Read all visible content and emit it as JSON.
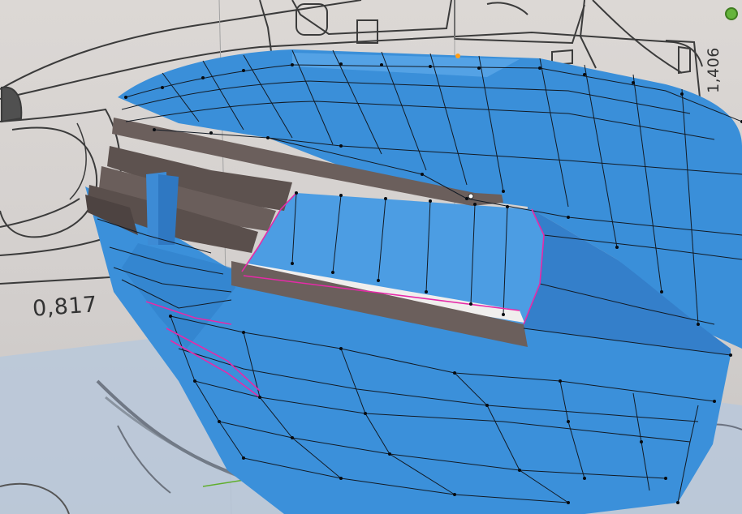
{
  "viewport": {
    "dimension_width": "0,817",
    "dimension_height": "1,406"
  },
  "colors": {
    "mesh_face": "#3a8fd9",
    "mesh_shadow": "#2c6fb6",
    "mesh_highlight": "#6ab2ee",
    "wire": "#121a24",
    "vertex": "#070b10",
    "seam": "#e62aa8",
    "grille": "#6b5f5c",
    "grille_dark": "#4d4341",
    "blueprint_bg": "#d9d6d3",
    "blueprint_line": "#3b3b3b",
    "floor": "#b8c7d8",
    "axis_green": "#5fae2b",
    "active_vertex": "#ff9f1a"
  },
  "icons": {
    "gizmo": "green-axis-gizmo-icon"
  }
}
